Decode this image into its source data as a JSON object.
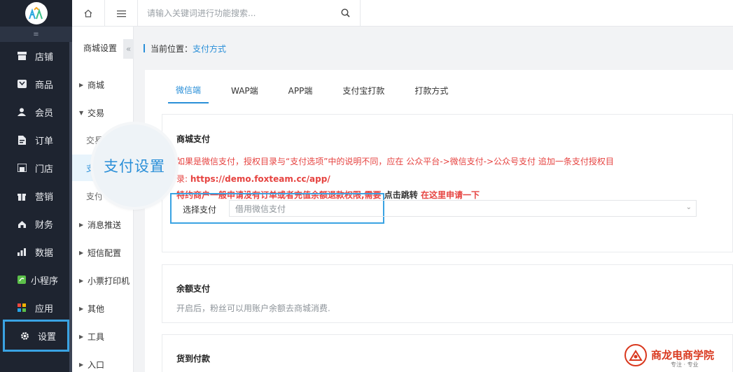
{
  "nav": {
    "items": [
      {
        "label": "店铺",
        "icon": "shop-icon"
      },
      {
        "label": "商品",
        "icon": "goods-icon"
      },
      {
        "label": "会员",
        "icon": "user-icon"
      },
      {
        "label": "订单",
        "icon": "order-icon"
      },
      {
        "label": "门店",
        "icon": "store-icon"
      },
      {
        "label": "营销",
        "icon": "gift-icon"
      },
      {
        "label": "财务",
        "icon": "finance-icon"
      },
      {
        "label": "数据",
        "icon": "chart-icon"
      },
      {
        "label": "小程序",
        "icon": "miniapp-icon"
      },
      {
        "label": "应用",
        "icon": "apps-icon"
      },
      {
        "label": "设置",
        "icon": "gear-icon"
      }
    ],
    "active": "设置",
    "active_color": "#3aa3e3"
  },
  "topbar": {
    "search_placeholder": "请输入关键词进行功能搜索..."
  },
  "subnav": {
    "title": "商城设置",
    "fold_glyph": "«",
    "items": [
      {
        "label": "商城",
        "expanded": false
      },
      {
        "label": "交易",
        "expanded": true
      },
      {
        "label": "消息推送",
        "expanded": false
      },
      {
        "label": "短信配置",
        "expanded": false
      },
      {
        "label": "小票打印机",
        "expanded": false
      },
      {
        "label": "其他",
        "expanded": false
      },
      {
        "label": "工具",
        "expanded": false
      },
      {
        "label": "入口",
        "expanded": false
      }
    ],
    "children": [
      "交易",
      "支",
      "支付"
    ]
  },
  "breadcrumb": {
    "prefix": "当前位置：",
    "current": "支付方式"
  },
  "tabs": [
    "微信端",
    "WAP端",
    "APP端",
    "支付宝打款",
    "打款方式"
  ],
  "active_tab": "微信端",
  "mall_pay": {
    "title": "商城支付",
    "note_line1": "如果是微信支付，授权目录与“支付选项”中的说明不同，应在 公众平台->微信支付->公众号支付 追加一条支付授权目",
    "note_line2_prefix": "录: ",
    "note_line2_url": "https://demo.foxteam.cc/app/",
    "note_line3_red": "特约商户一般申请没有订单或者充值余额退款权限,需要 ",
    "note_line3_dark": "点击跳转",
    "note_line3_red2": " 在这里申请一下",
    "select_label": "选择支付",
    "select_value": "借用微信支付"
  },
  "balance_pay": {
    "title": "余额支付",
    "desc": "开启后，粉丝可以用账户余额去商城消费."
  },
  "cod_pay": {
    "title": "货到付款"
  },
  "magnifier_text": "支付设置",
  "watermark": {
    "title": "商龙电商学院",
    "sub": "专注 · 专业"
  }
}
